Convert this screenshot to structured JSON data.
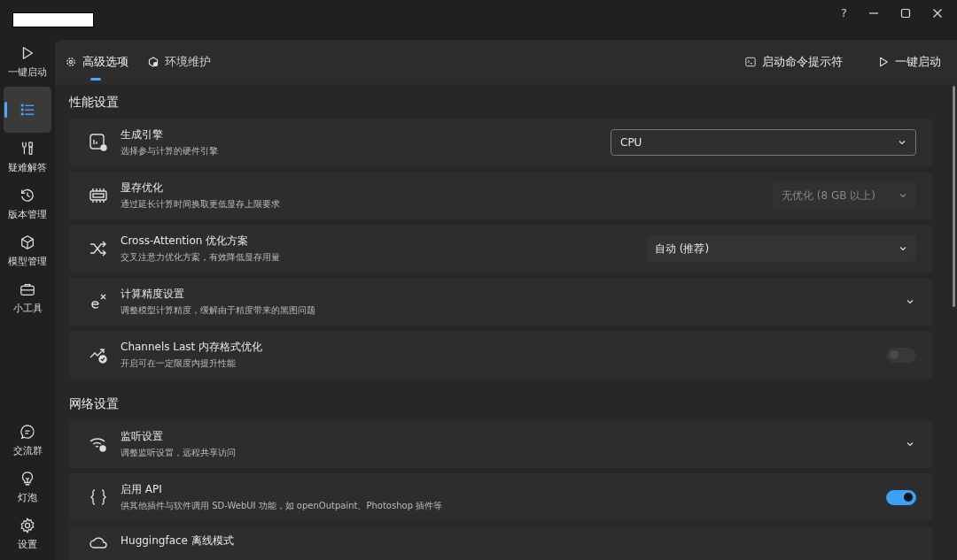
{
  "window": {
    "controls": [
      "?"
    ]
  },
  "sidebar": {
    "items": [
      {
        "label": "一键启动",
        "selected": false
      },
      {
        "selected": true
      },
      {
        "label": "疑难解答",
        "selected": false
      },
      {
        "label": "版本管理",
        "selected": false
      },
      {
        "label": "模型管理",
        "selected": false
      },
      {
        "label": "小工具",
        "selected": false
      }
    ],
    "bottom_items": [
      {
        "label": "交流群"
      },
      {
        "label": "灯泡"
      },
      {
        "label": "设置"
      }
    ]
  },
  "tabs": [
    {
      "label": "高级选项",
      "selected": true
    },
    {
      "label": "环境维护",
      "selected": false
    }
  ],
  "actions": [
    {
      "label": "启动命令提示符"
    },
    {
      "label": "一键启动"
    }
  ],
  "sections": [
    {
      "title": "性能设置",
      "rows": [
        {
          "kind": "select",
          "title": "生成引擎",
          "subtitle": "选择参与计算的硬件引擎",
          "value": "CPU",
          "focused": true,
          "disabled": false
        },
        {
          "kind": "select",
          "title": "显存优化",
          "subtitle": "通过延长计算时间换取更低显存上限要求",
          "value": "无优化 (8 GB 以上)",
          "focused": false,
          "disabled": true
        },
        {
          "kind": "select",
          "title": "Cross-Attention 优化方案",
          "subtitle": "交叉注意力优化方案，有效降低显存用量",
          "value": "自动 (推荐)",
          "focused": false,
          "disabled": false
        },
        {
          "kind": "expander",
          "title": "计算精度设置",
          "subtitle": "调整模型计算精度，缓解由于精度带来的黑图问题"
        },
        {
          "kind": "toggle",
          "title": "Channels Last 内存格式优化",
          "subtitle": "开启可在一定限度内提升性能",
          "on": false,
          "disabled": true
        }
      ]
    },
    {
      "title": "网络设置",
      "rows": [
        {
          "kind": "expander",
          "title": "监听设置",
          "subtitle": "调整监听设置，远程共享访问"
        },
        {
          "kind": "toggle",
          "title": "启用 API",
          "subtitle": "供其他插件与软件调用 SD-WebUI 功能，如 openOutpaint、Photoshop 插件等",
          "on": true
        },
        {
          "title": "Huggingface 离线模式"
        }
      ]
    }
  ]
}
